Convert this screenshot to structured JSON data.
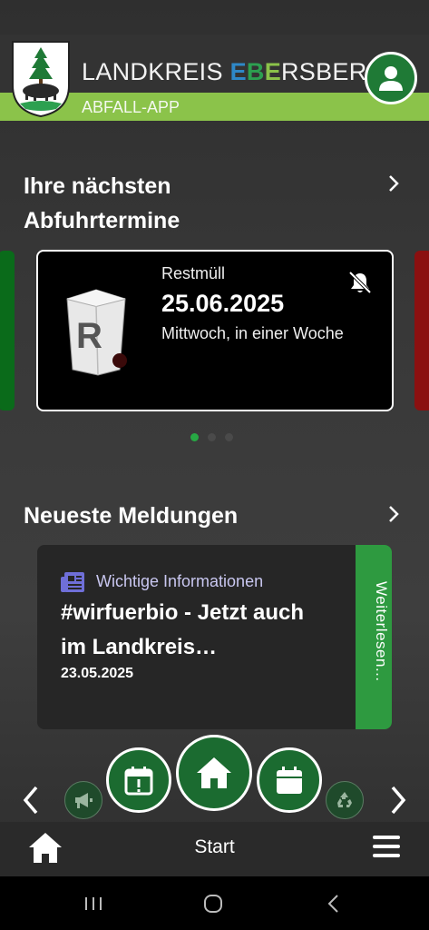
{
  "header": {
    "brand_prefix": "LANDKREIS ",
    "brand_e1": "E",
    "brand_b": "B",
    "brand_e2": "E",
    "brand_suffix": "RSBERG",
    "subtitle": "ABFALL-APP",
    "logo_icon": "coat-of-arms-icon",
    "profile_icon": "user-icon"
  },
  "pickups": {
    "title_line1": "Ihre nächsten",
    "title_line2": "Abfuhrtermine",
    "card": {
      "type": "Restmüll",
      "date": "25.06.2025",
      "relative": "Mittwoch, in einer Woche",
      "bin_letter": "R",
      "notification": "bell-off-icon"
    },
    "pagination": {
      "count": 3,
      "active": 0
    }
  },
  "news": {
    "title": "Neueste Meldungen",
    "card": {
      "category": "Wichtige Informationen",
      "headline": "#wirfuerbio - Jetzt auch im Landkreis…",
      "date": "23.05.2025",
      "more": "Weiterlesen..."
    }
  },
  "actions": {
    "items": [
      "megaphone-icon",
      "calendar-alert-icon",
      "home-icon",
      "calendar-icon",
      "recycle-icon"
    ]
  },
  "bottom_bar": {
    "label": "Start"
  },
  "colors": {
    "accent_green": "#8bc34a",
    "dark_green": "#1b6b30",
    "brand_blue": "#2e88c8"
  }
}
